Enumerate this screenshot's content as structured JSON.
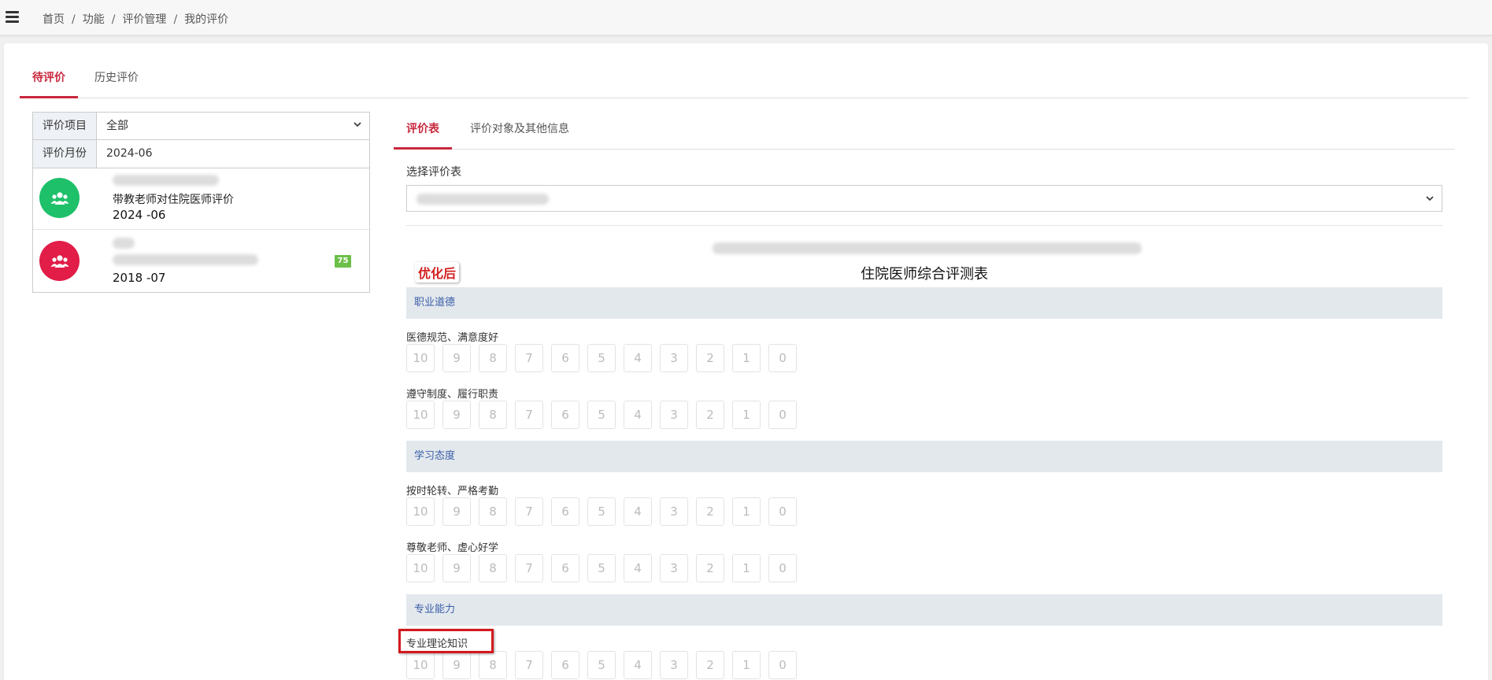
{
  "breadcrumb": [
    "首页",
    "功能",
    "评价管理",
    "我的评价"
  ],
  "main_tabs": [
    {
      "label": "待评价"
    },
    {
      "label": "历史评价"
    }
  ],
  "filter": {
    "project_label": "评价项目",
    "project_value": "全部",
    "month_label": "评价月份",
    "month_value": "2024-06"
  },
  "eval_list": [
    {
      "title": "带教老师对住院医师评价",
      "date": "2024 -06",
      "avatar_color": "#1ec06a",
      "icon": "users-icon"
    },
    {
      "date": "2018 -07",
      "avatar_color": "#e11d48",
      "score": "75",
      "icon": "users-icon"
    }
  ],
  "sub_tabs": [
    {
      "label": "评价表"
    },
    {
      "label": "评价对象及其他信息"
    }
  ],
  "select_form_label": "选择评价表",
  "form": {
    "title": "住院医师综合评测表",
    "optimized_tag": "优化后",
    "sections": [
      {
        "name": "职业道德",
        "items": [
          "医德规范、满意度好",
          "遵守制度、履行职责"
        ]
      },
      {
        "name": "学习态度",
        "items": [
          "按时轮转、严格考勤",
          "尊敬老师、虚心好学"
        ]
      },
      {
        "name": "专业能力",
        "items": [
          "专业理论知识"
        ]
      }
    ],
    "score_options": [
      "10",
      "9",
      "8",
      "7",
      "6",
      "5",
      "4",
      "3",
      "2",
      "1",
      "0"
    ]
  },
  "colors": {
    "accent": "#c9283e",
    "section_text": "#3a5ea8",
    "section_bg": "#e3e8ed",
    "highlight": "#d4181e"
  }
}
